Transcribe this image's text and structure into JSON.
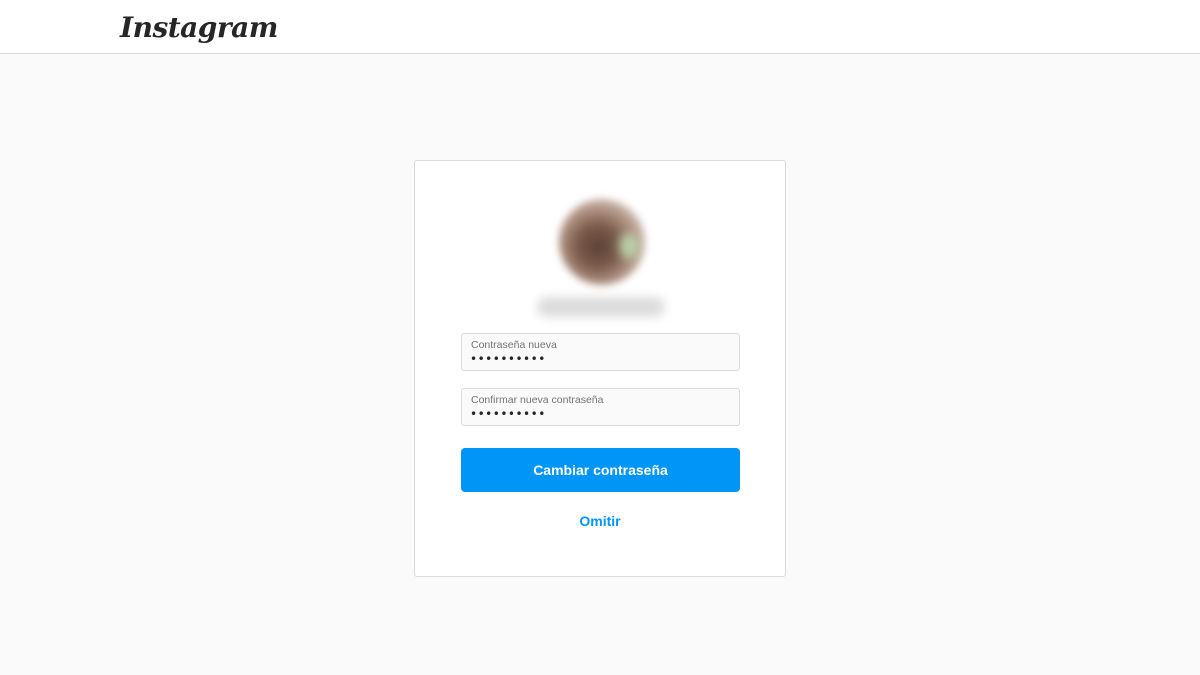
{
  "header": {
    "logo_text": "Instagram"
  },
  "reset_form": {
    "new_password": {
      "label": "Contraseña nueva",
      "value": "••••••••••"
    },
    "confirm_password": {
      "label": "Confirmar nueva contraseña",
      "value": "••••••••••"
    },
    "submit_label": "Cambiar contraseña",
    "skip_label": "Omitir"
  },
  "colors": {
    "accent": "#0095f6",
    "page_background": "#fafafa",
    "border": "#dbdbdb"
  }
}
